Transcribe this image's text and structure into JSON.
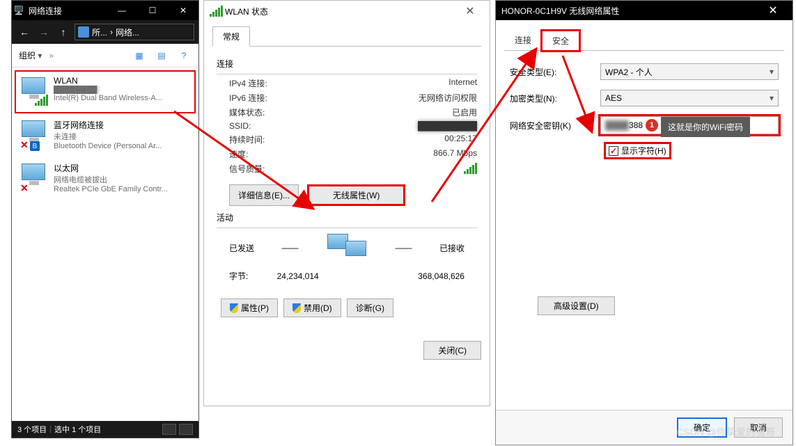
{
  "left_window": {
    "title": "网络连接",
    "breadcrumb_1": "所...",
    "breadcrumb_2": "网络...",
    "toolbar": {
      "organize": "组织"
    },
    "connections": [
      {
        "name": "WLAN",
        "sub1_blurred": "████████",
        "sub2": "Intel(R) Dual Band Wireless-A..."
      },
      {
        "name": "蓝牙网络连接",
        "sub1": "未连接",
        "sub2": "Bluetooth Device (Personal Ar..."
      },
      {
        "name": "以太网",
        "sub1": "网络电缆被拔出",
        "sub2": "Realtek PCIe GbE Family Contr..."
      }
    ],
    "status": {
      "items": "3 个项目",
      "selected": "选中 1 个项目"
    }
  },
  "mid_window": {
    "title": "WLAN 状态",
    "tab_general": "常规",
    "group_connection": "连接",
    "kv": {
      "ipv4_k": "IPv4 连接:",
      "ipv4_v": "Internet",
      "ipv6_k": "IPv6 连接:",
      "ipv6_v": "无网络访问权限",
      "media_k": "媒体状态:",
      "media_v": "已启用",
      "ssid_k": "SSID:",
      "ssid_v_blurred": "██████████",
      "dur_k": "持续时间:",
      "dur_v": "00:25:17",
      "speed_k": "速度:",
      "speed_v": "866.7 Mbps",
      "sigq_k": "信号质量:"
    },
    "btn_details": "详细信息(E)...",
    "btn_wireless": "无线属性(W)",
    "group_activity": "活动",
    "activity": {
      "sent_label": "已发送",
      "recv_label": "已接收",
      "bytes_label": "字节:",
      "sent_bytes": "24,234,014",
      "recv_bytes": "368,048,626"
    },
    "btn_props": "属性(P)",
    "btn_disable": "禁用(D)",
    "btn_diag": "诊断(G)",
    "btn_close": "关闭(C)"
  },
  "right_window": {
    "title": "HONOR-0C1H9V 无线网络属性",
    "tab_connect": "连接",
    "tab_security": "安全",
    "form": {
      "sectype_lbl": "安全类型(E):",
      "sectype_val": "WPA2 - 个人",
      "enctype_lbl": "加密类型(N):",
      "enctype_val": "AES",
      "key_lbl": "网络安全密钥(K)",
      "key_val_prefix_blurred": "████",
      "key_val_suffix": "388",
      "tooltip": "这就是你的WiFi密码",
      "showchars": "显示字符(H)"
    },
    "btn_advanced": "高级设置(D)",
    "btn_ok": "确定",
    "btn_cancel": "取消"
  },
  "watermark": "CSDN @你挚爱的强哥"
}
